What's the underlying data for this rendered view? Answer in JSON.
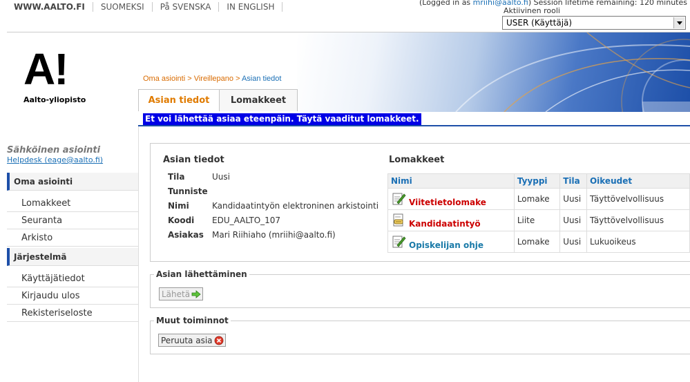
{
  "topnav": [
    "WWW.AALTO.FI",
    "SUOMEKSI",
    "På SVENSKA",
    "IN ENGLISH"
  ],
  "session": {
    "prefix": "(Logged in as ",
    "user": "mriihi@aalto.fi",
    "suffix": ") Session lifetime remaining: 120 minutes"
  },
  "role": {
    "label": "Aktiivinen rooli",
    "selected": "USER (Käyttäjä)"
  },
  "logo": {
    "mark": "A!",
    "name": "Aalto-yliopisto"
  },
  "breadcrumb": {
    "items": [
      "Oma asiointi",
      "Vireillepano"
    ],
    "separator": ">",
    "current": "Asian tiedot"
  },
  "tabs": [
    "Asian tiedot",
    "Lomakkeet"
  ],
  "warning": "Et voi lähettää asiaa eteenpäin. Täytä vaaditut lomakkeet.",
  "sidebar": {
    "title": "Sähköinen asiointi",
    "help": "Helpdesk (eage@aalto.fi)",
    "sections": [
      {
        "label": "Oma asiointi",
        "items": [
          "Lomakkeet",
          "Seuranta",
          "Arkisto"
        ]
      },
      {
        "label": "Järjestelmä",
        "items": [
          "Käyttäjätiedot",
          "Kirjaudu ulos",
          "Rekisteriseloste"
        ]
      }
    ]
  },
  "details": {
    "title": "Asian tiedot",
    "rows": [
      {
        "key": "Tila",
        "value": "Uusi"
      },
      {
        "key": "Tunniste",
        "value": ""
      },
      {
        "key": "Nimi",
        "value": "Kandidaatintyön elektroninen arkistointi"
      },
      {
        "key": "Koodi",
        "value": "EDU_AALTO_107"
      },
      {
        "key": "Asiakas",
        "value": "Mari Riihiaho (mriihi@aalto.fi)"
      }
    ]
  },
  "forms": {
    "title": "Lomakkeet",
    "headers": [
      "Nimi",
      "Tyyppi",
      "Tila",
      "Oikeudet"
    ],
    "rows": [
      {
        "name": "Viitetietolomake",
        "type": "Lomake",
        "status": "Uusi",
        "rights": "Täyttövelvollisuus",
        "color": "#cc0000",
        "icon": "form-edit-icon"
      },
      {
        "name": "Kandidaatintyö",
        "type": "Liite",
        "status": "Uusi",
        "rights": "Täyttövelvollisuus",
        "color": "#cc0000",
        "icon": "attachment-icon"
      },
      {
        "name": "Opiskelijan ohje",
        "type": "Lomake",
        "status": "Uusi",
        "rights": "Lukuoikeus",
        "color": "#1a7aa8",
        "icon": "form-edit-icon"
      }
    ]
  },
  "send": {
    "legend": "Asian lähettäminen",
    "button": "Lähetä",
    "icon": "arrow-right-icon"
  },
  "other": {
    "legend": "Muut toiminnot",
    "button": "Peruuta asia",
    "icon": "cancel-icon"
  }
}
